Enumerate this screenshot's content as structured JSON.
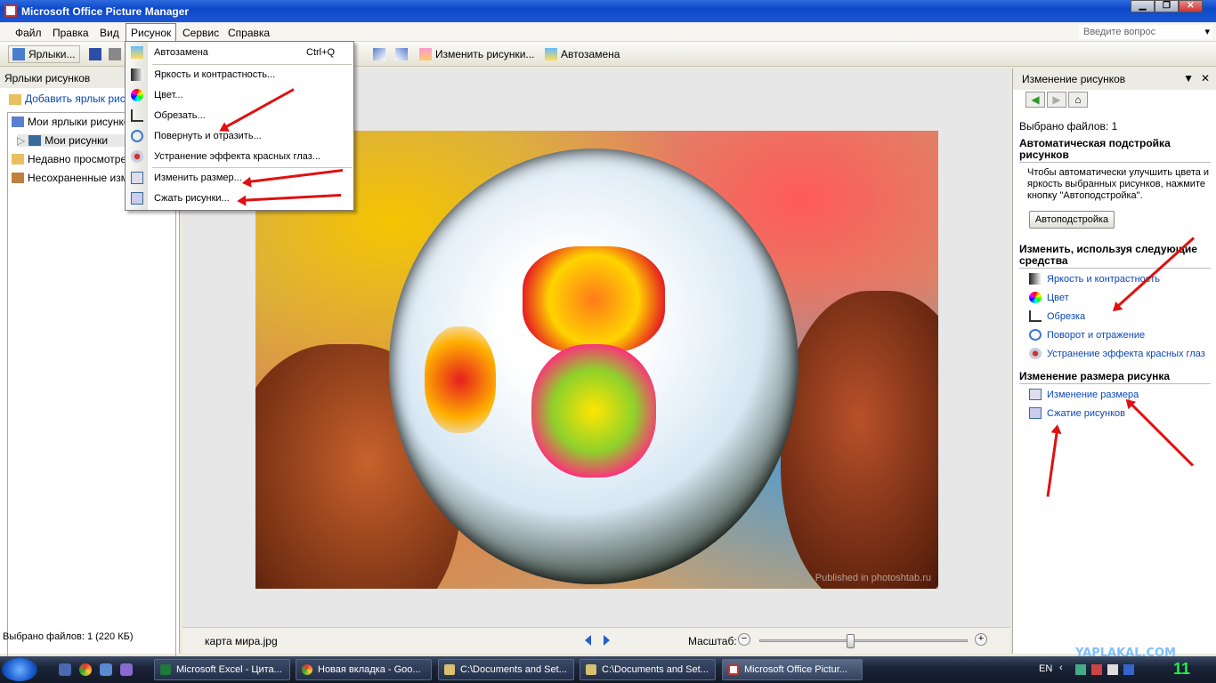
{
  "window": {
    "title": "Microsoft Office Picture Manager",
    "min": "▁",
    "max": "❐",
    "close": "✕"
  },
  "menubar": {
    "items": [
      "Файл",
      "Правка",
      "Вид",
      "Рисунок",
      "Сервис",
      "Справка"
    ],
    "ask_placeholder": "Введите вопрос"
  },
  "toolbar": {
    "shortcuts": "Ярлыки...",
    "edit_pictures": "Изменить рисунки...",
    "auto_correct": "Автозамена"
  },
  "dropdown": {
    "items": [
      {
        "label": "Автозамена",
        "shortcut": "Ctrl+Q",
        "icon": "autocorrect-icon"
      },
      {
        "label": "Яркость и контрастность...",
        "icon": "brightness-icon"
      },
      {
        "label": "Цвет...",
        "icon": "color-icon"
      },
      {
        "label": "Обрезать...",
        "icon": "crop-icon"
      },
      {
        "label": "Повернуть и отразить...",
        "icon": "rotate-icon"
      },
      {
        "label": "Устранение эффекта красных глаз...",
        "icon": "red-eye-icon"
      },
      {
        "label": "Изменить размер...",
        "icon": "resize-icon"
      },
      {
        "label": "Сжать рисунки...",
        "icon": "compress-icon"
      }
    ]
  },
  "left_panel": {
    "header": "Ярлыки рисунков",
    "add_shortcut": "Добавить ярлык рисунка",
    "tree": [
      "Мои ярлыки рисунков",
      "Мои рисунки",
      "Недавно просмотренные",
      "Несохраненные изменения"
    ],
    "status": "Выбрано файлов: 1 (220 КБ)"
  },
  "center": {
    "photo_watermark": "Published in photoshtab.ru",
    "file_name": "карта мира.jpg",
    "zoom_label": "Масштаб:",
    "zoom_level": 0.43
  },
  "right_panel": {
    "header": "Изменение рисунков",
    "selected": "Выбрано файлов: 1",
    "auto_title": "Автоматическая подстройка рисунков",
    "auto_text": "Чтобы автоматически улучшить цвета и яркость выбранных рисунков, нажмите кнопку \"Автоподстройка\".",
    "auto_button": "Автоподстройка",
    "tools_title": "Изменить, используя следующие средства",
    "tools": [
      "Яркость и контрастность",
      "Цвет",
      "Обрезка",
      "Поворот и отражение",
      "Устранение эффекта красных глаз"
    ],
    "resize_title": "Изменение размера рисунка",
    "resize_links": [
      "Изменение размера",
      "Сжатие рисунков"
    ]
  },
  "taskbar": {
    "tasks": [
      "Microsoft Excel - Цита...",
      "Новая вкладка - Goo...",
      "C:\\Documents and Set...",
      "C:\\Documents and Set...",
      "Microsoft Office Pictur..."
    ],
    "lang": "EN",
    "clock": "11",
    "site": "YAPLAKAL.COM"
  }
}
